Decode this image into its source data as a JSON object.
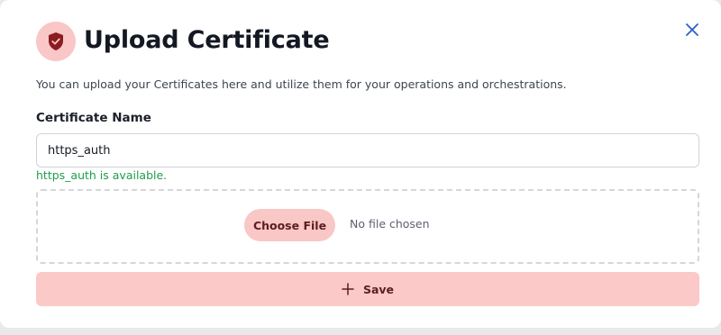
{
  "dialog": {
    "title": "Upload Certificate",
    "header_icon": "shield-check-icon",
    "close_icon": "close-icon",
    "description": "You can upload your Certificates here and utilize them for your operations and orchestrations."
  },
  "form": {
    "name_label": "Certificate Name",
    "name_value": "https_auth",
    "availability_message": "https_auth is available.",
    "file": {
      "choose_label": "Choose File",
      "status": "No file chosen"
    },
    "save": {
      "icon": "plus-icon",
      "label": "Save"
    }
  },
  "colors": {
    "accent": "#f9c7c6",
    "accent_dark": "#8b1c22",
    "success": "#1f9d4c",
    "close": "#2a62c9"
  }
}
